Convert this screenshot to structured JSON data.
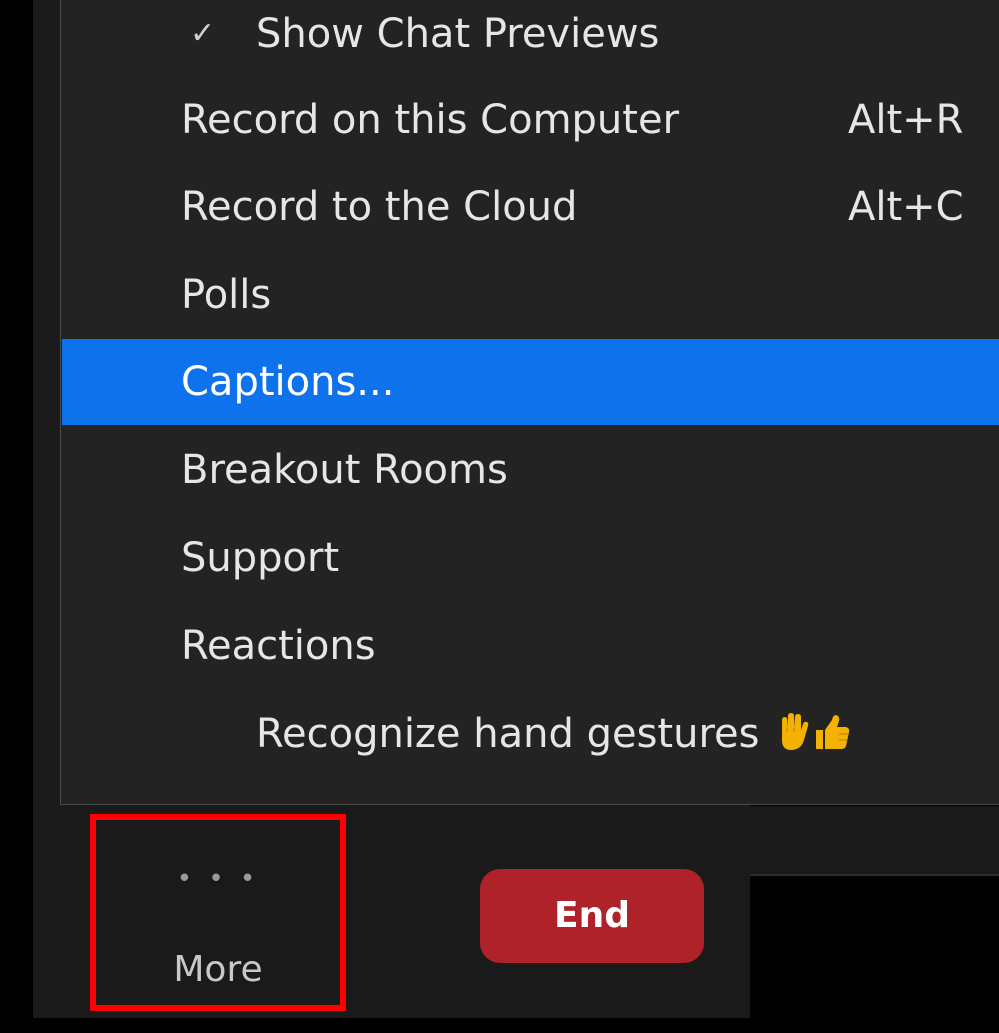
{
  "menu": {
    "items": [
      {
        "label": "Show Chat Previews",
        "checked": true
      },
      {
        "label": "Record on this Computer",
        "shortcut": "Alt+R"
      },
      {
        "label": "Record to the Cloud",
        "shortcut": "Alt+C"
      },
      {
        "label": "Polls"
      },
      {
        "label": "Captions...",
        "highlighted": true
      },
      {
        "label": "Breakout Rooms"
      },
      {
        "label": "Support"
      },
      {
        "label": "Reactions"
      },
      {
        "label": "Recognize hand gestures",
        "icons": [
          "raised-hand-icon",
          "thumbs-up-icon"
        ]
      }
    ],
    "check_glyph": "✓"
  },
  "toolbar": {
    "more_icon": "• • •",
    "more_label": "More",
    "end_label": "End"
  },
  "colors": {
    "highlight": "#0e72ed",
    "end_button": "#b0222a",
    "focus_outline": "#ff0000"
  }
}
